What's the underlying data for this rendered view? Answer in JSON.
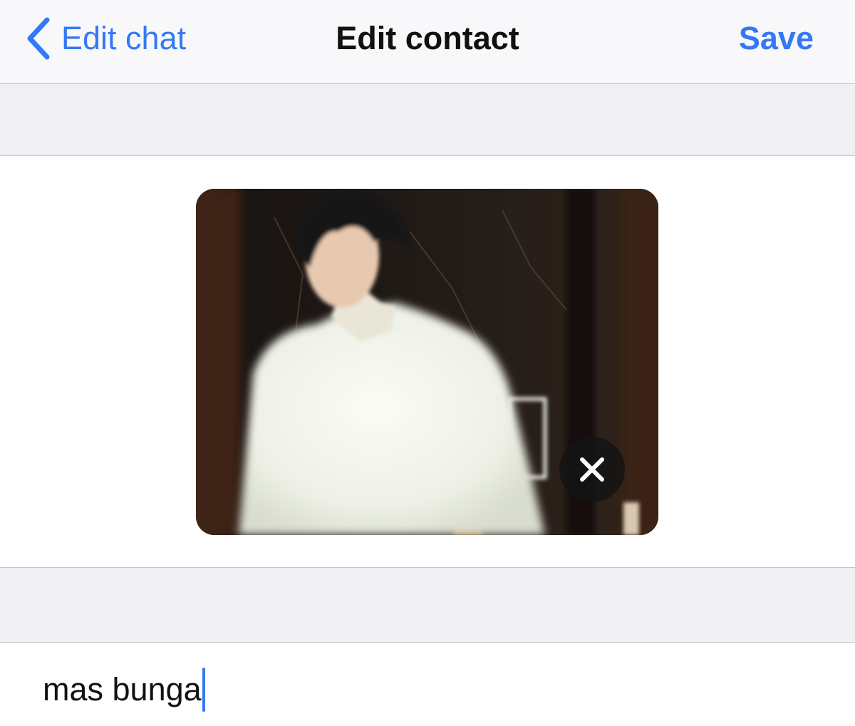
{
  "nav": {
    "back_label": "Edit chat",
    "title": "Edit contact",
    "save_label": "Save"
  },
  "photo": {
    "remove_icon": "close-icon"
  },
  "name_field": {
    "value": "mas bunga"
  },
  "colors": {
    "accent": "#3478f6",
    "nav_background": "#f8f8fa",
    "group_background": "#efeff4",
    "separator": "#c6c6c8"
  }
}
